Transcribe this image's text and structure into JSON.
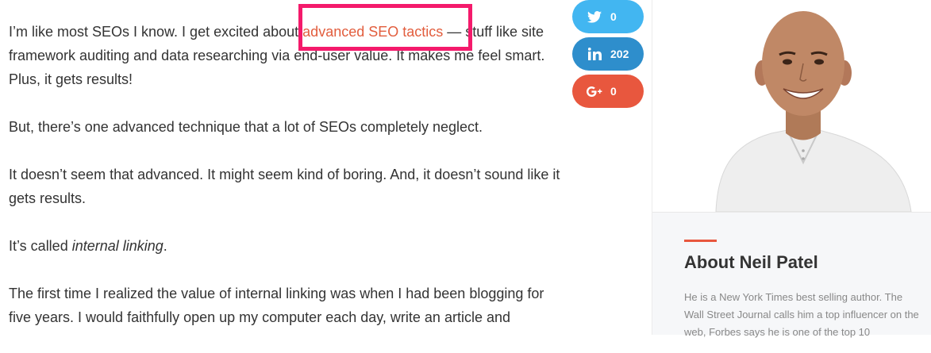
{
  "article": {
    "p1_before": "I’m like most SEOs I know.  I get excited about ",
    "p1_link": "advanced SEO tactics",
    "p1_after": " — stuff like site framework auditing and data researching via end-user value. It makes me feel smart. Plus, it gets results!",
    "p2": "But, there’s one advanced technique that a lot of SEOs completely neglect.",
    "p3": "It doesn’t seem that advanced. It might seem kind of boring. And, it doesn’t sound like it gets results.",
    "p4_before": "It’s called ",
    "p4_em": "internal linking",
    "p4_after": ".",
    "p5": "The first time I realized the value of internal linking was when I had been blogging for five years. I would faithfully open up my computer each day, write an article and"
  },
  "share": {
    "twitter": {
      "icon": "twitter-icon",
      "count": "0",
      "color": "#42b6f1"
    },
    "linkedin": {
      "icon": "linkedin-icon",
      "count": "202",
      "color": "#2e8ecc"
    },
    "google": {
      "icon": "google-plus-icon",
      "count": "0",
      "color": "#e8573e"
    }
  },
  "sidebar": {
    "about_title": "About Neil Patel",
    "about_text": "He is a New York Times best selling author. The Wall Street Journal calls him a top influencer on the web, Forbes says he is one of the top 10"
  },
  "colors": {
    "link": "#e25d3d",
    "highlight_border": "#f41a6b",
    "accent": "#e8573e"
  }
}
